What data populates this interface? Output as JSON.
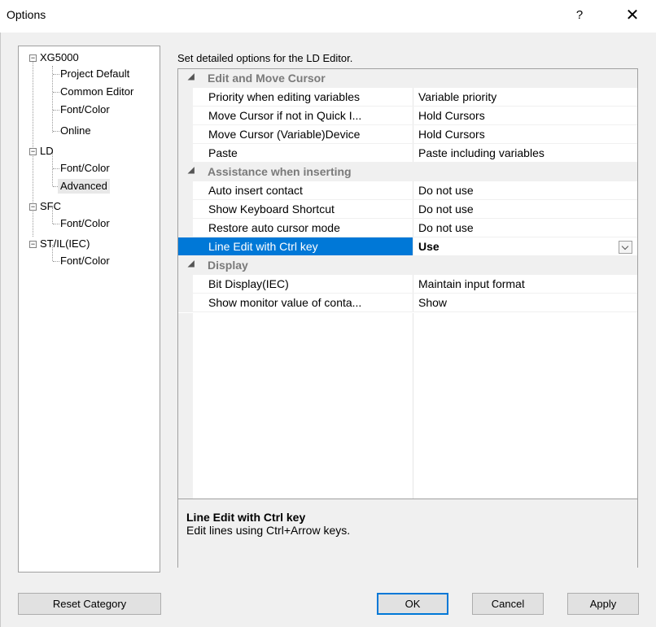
{
  "window": {
    "title": "Options",
    "help_label": "?",
    "close_label": "✕"
  },
  "tree": {
    "nodes": [
      {
        "label": "XG5000",
        "expander": "−"
      },
      {
        "label": "Project Default"
      },
      {
        "label": "Common Editor"
      },
      {
        "label": "Font/Color"
      },
      {
        "label": "Online"
      },
      {
        "label": "LD",
        "expander": "−"
      },
      {
        "label": "Font/Color"
      },
      {
        "label": "Advanced",
        "selected": true
      },
      {
        "label": "SFC",
        "expander": "−"
      },
      {
        "label": "Font/Color"
      },
      {
        "label": "ST/IL(IEC)",
        "expander": "−"
      },
      {
        "label": "Font/Color"
      }
    ]
  },
  "panel": {
    "caption": "Set detailed options for the LD Editor.",
    "categories": [
      {
        "name": "Edit and Move Cursor",
        "rows": [
          {
            "prop": "Priority when editing variables",
            "value": "Variable priority"
          },
          {
            "prop": "Move Cursor if not in Quick I...",
            "value": "Hold Cursors"
          },
          {
            "prop": "Move Cursor (Variable)Device",
            "value": "Hold Cursors"
          },
          {
            "prop": "Paste",
            "value": "Paste including variables"
          }
        ]
      },
      {
        "name": "Assistance when inserting",
        "rows": [
          {
            "prop": "Auto insert contact",
            "value": "Do not use"
          },
          {
            "prop": "Show Keyboard Shortcut",
            "value": "Do not use"
          },
          {
            "prop": "Restore auto cursor mode",
            "value": "Do not use"
          },
          {
            "prop": "Line Edit with Ctrl key",
            "value": "Use",
            "selected": true
          }
        ]
      },
      {
        "name": "Display",
        "rows": [
          {
            "prop": "Bit Display(IEC)",
            "value": "Maintain input format"
          },
          {
            "prop": "Show monitor value of conta...",
            "value": "Show"
          }
        ]
      }
    ],
    "collapse_glyph": "◢",
    "description": {
      "title": "Line Edit with Ctrl key",
      "text": "Edit lines using Ctrl+Arrow keys."
    }
  },
  "buttons": {
    "reset": "Reset Category",
    "ok": "OK",
    "cancel": "Cancel",
    "apply": "Apply"
  },
  "colors": {
    "selection": "#0078d7",
    "background": "#f0f0f0"
  }
}
